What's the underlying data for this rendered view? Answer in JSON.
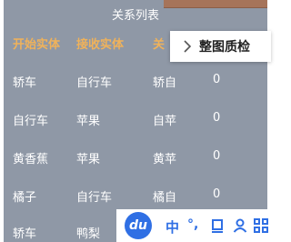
{
  "title": "关系列表",
  "headers": [
    "开始实体",
    "接收实体",
    "关"
  ],
  "rows": [
    [
      "轿车",
      "自行车",
      "轿自",
      "0"
    ],
    [
      "自行车",
      "苹果",
      "自苹",
      "0"
    ],
    [
      "黄香蕉",
      "苹果",
      "黄苹",
      "0"
    ],
    [
      "橘子",
      "自行车",
      "橘自",
      "0"
    ],
    [
      "轿车",
      "鸭梨",
      "",
      ""
    ]
  ],
  "popup": {
    "label": "整图质检",
    "icon": "chevron-right-icon"
  },
  "ime_bar": {
    "logo": "du",
    "chinese_mode": "中",
    "punct": "°,",
    "icons": [
      "cup-icon",
      "person-icon",
      "grid-icon"
    ]
  },
  "colors": {
    "panel_bg": "#8f98a6",
    "header_text": "#f0b25a",
    "ime_accent": "#2f6fe4"
  }
}
